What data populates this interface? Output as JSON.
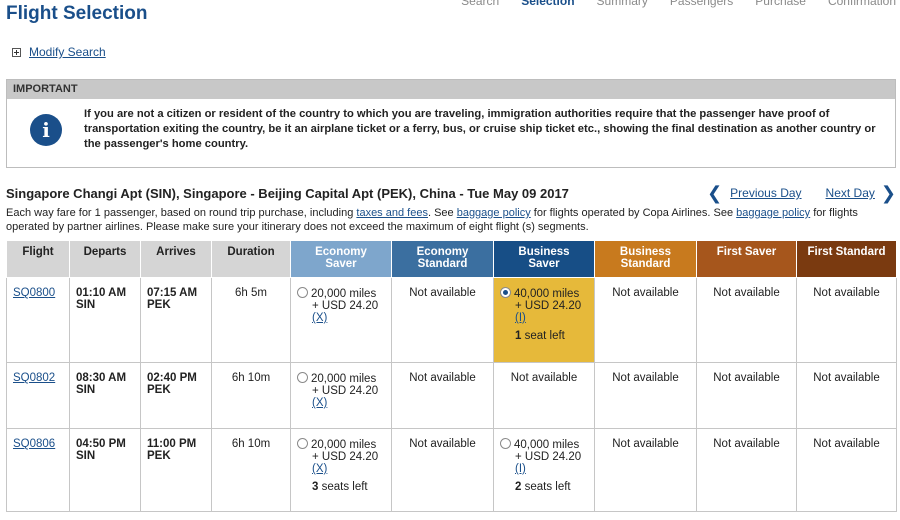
{
  "page": {
    "title": "Flight Selection",
    "steps": [
      "Search",
      "Selection",
      "Summary",
      "Passengers",
      "Purchase",
      "Confirmation"
    ],
    "active_step": "Selection"
  },
  "modify_search": "Modify Search",
  "important": {
    "heading": "IMPORTANT",
    "text": "If you are not a citizen or resident of the country to which you are traveling, immigration authorities require that the passenger have proof of transportation exiting the country, be it an airplane ticket or a ferry, bus, or cruise ship ticket etc., showing the final destination as another country or the passenger's home country."
  },
  "route": {
    "title": "Singapore Changi Apt (SIN), Singapore - Beijing Capital Apt (PEK), China - Tue May 09 2017",
    "prev_day": "Previous Day",
    "next_day": "Next Day"
  },
  "fare_note": {
    "part1": "Each way fare for 1 passenger, based on round trip purchase, including ",
    "link1": "taxes and fees",
    "part2": ". See ",
    "link2": "baggage policy",
    "part3": " for flights operated by Copa Airlines. See ",
    "link3": "baggage policy",
    "part4": " for flights operated by partner airlines. Please make sure your itinerary does not exceed the maximum of eight flight (s) segments."
  },
  "columns": {
    "flight": "Flight",
    "departs": "Departs",
    "arrives": "Arrives",
    "duration": "Duration",
    "economy_saver": [
      "Economy",
      "Saver"
    ],
    "economy_standard": [
      "Economy",
      "Standard"
    ],
    "business_saver": [
      "Business",
      "Saver"
    ],
    "business_standard": [
      "Business",
      "Standard"
    ],
    "first_saver": "First Saver",
    "first_standard": "First Standard"
  },
  "colors": {
    "economy_saver": "#7ea6cc",
    "economy_standard": "#3b6fa0",
    "business_saver": "#174e86",
    "business_standard": "#c87a1e",
    "first_saver": "#a6561c",
    "first_standard": "#7a3a10",
    "selected_fare": "#e6b93a"
  },
  "na": "Not available",
  "rows": [
    {
      "flight": "SQ0800",
      "dep_time": "01:10 AM",
      "dep_code": "SIN",
      "arr_time": "07:15 AM",
      "arr_code": "PEK",
      "duration": "6h 5m",
      "econ_saver": {
        "miles": "20,000 miles",
        "usd": "+ USD 24.20",
        "flag": "(X)",
        "seats_num": "",
        "seats_txt": ""
      },
      "bus_saver": {
        "available": true,
        "selected": true,
        "miles": "40,000 miles",
        "usd": "+ USD 24.20",
        "flag": "(I)",
        "seats_num": "1",
        "seats_txt": " seat left"
      }
    },
    {
      "flight": "SQ0802",
      "dep_time": "08:30 AM",
      "dep_code": "SIN",
      "arr_time": "02:40 PM",
      "arr_code": "PEK",
      "duration": "6h 10m",
      "econ_saver": {
        "miles": "20,000 miles",
        "usd": "+ USD 24.20",
        "flag": "(X)",
        "seats_num": "",
        "seats_txt": ""
      },
      "bus_saver": {
        "available": false
      }
    },
    {
      "flight": "SQ0806",
      "dep_time": "04:50 PM",
      "dep_code": "SIN",
      "arr_time": "11:00 PM",
      "arr_code": "PEK",
      "duration": "6h 10m",
      "econ_saver": {
        "miles": "20,000 miles",
        "usd": "+ USD 24.20",
        "flag": "(X)",
        "seats_num": "3",
        "seats_txt": " seats left"
      },
      "bus_saver": {
        "available": true,
        "selected": false,
        "miles": "40,000 miles",
        "usd": "+ USD 24.20",
        "flag": "(I)",
        "seats_num": "2",
        "seats_txt": " seats left"
      }
    }
  ]
}
